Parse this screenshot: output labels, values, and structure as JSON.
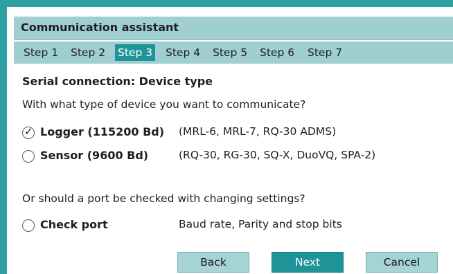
{
  "window": {
    "title": "Communication assistant"
  },
  "steps": [
    {
      "label": "Step 1"
    },
    {
      "label": "Step 2"
    },
    {
      "label": "Step 3"
    },
    {
      "label": "Step 4"
    },
    {
      "label": "Step 5"
    },
    {
      "label": "Step 6"
    },
    {
      "label": "Step 7"
    }
  ],
  "active_step": 3,
  "section": {
    "heading": "Serial connection: Device type",
    "question": "With what type of device you want to communicate?"
  },
  "options": [
    {
      "label": "Logger (115200 Bd)",
      "description": "(MRL-6, MRL-7, RQ-30 ADMS)",
      "checked": true
    },
    {
      "label": "Sensor (9600 Bd)",
      "description": "(RQ-30, RG-30, SQ-X, DuoVQ, SPA-2)",
      "checked": false
    }
  ],
  "port_check": {
    "question": "Or should a port be checked with changing settings?",
    "label": "Check port",
    "description": "Baud rate, Parity and stop bits",
    "checked": false
  },
  "buttons": {
    "back": "Back",
    "next": "Next",
    "cancel": "Cancel"
  },
  "colors": {
    "accent": "#1f9498",
    "header_bg": "#9fcfd0",
    "frame": "#2e9fa3"
  }
}
